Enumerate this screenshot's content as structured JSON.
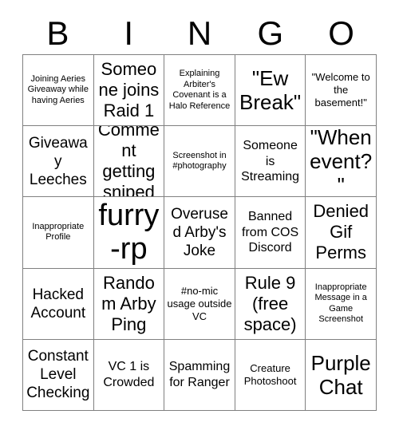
{
  "card": {
    "header_letters": [
      "B",
      "I",
      "N",
      "G",
      "O"
    ],
    "colors": {
      "background": "#ffffff",
      "text": "#000000",
      "grid_line": "#808080"
    },
    "cells": [
      {
        "text": "Joining Aeries Giveaway while having Aeries",
        "size": "fs-xs"
      },
      {
        "text": "Someone joins Raid 1",
        "size": "fs-xl"
      },
      {
        "text": "Explaining Arbiter's Covenant is a Halo Reference",
        "size": "fs-xs"
      },
      {
        "text": "\"Ew Break\"",
        "size": "fs-xxl"
      },
      {
        "text": "\"Welcome to the basement!\"",
        "size": "fs-sm"
      },
      {
        "text": "Giveaway Leeches",
        "size": "fs-lg"
      },
      {
        "text": "Comment getting sniped",
        "size": "fs-xl"
      },
      {
        "text": "Screenshot in #photography",
        "size": "fs-xs"
      },
      {
        "text": "Someone is Streaming",
        "size": "fs-md"
      },
      {
        "text": "\"When event?\"",
        "size": "fs-xxl"
      },
      {
        "text": "Inappropriate Profile",
        "size": "fs-xs"
      },
      {
        "text": "furry-rp",
        "size": "fs-huge"
      },
      {
        "text": "Overused Arby's Joke",
        "size": "fs-lg"
      },
      {
        "text": "Banned from COS Discord",
        "size": "fs-md"
      },
      {
        "text": "Denied Gif Perms",
        "size": "fs-xl"
      },
      {
        "text": "Hacked Account",
        "size": "fs-lg"
      },
      {
        "text": "Random Arby Ping",
        "size": "fs-xl"
      },
      {
        "text": "#no-mic usage outside VC",
        "size": "fs-sm"
      },
      {
        "text": "Rule 9 (free space)",
        "size": "fs-xl"
      },
      {
        "text": "Inappropriate Message in a Game Screenshot",
        "size": "fs-xs"
      },
      {
        "text": "Constant Level Checking",
        "size": "fs-lg"
      },
      {
        "text": "VC 1 is Crowded",
        "size": "fs-md"
      },
      {
        "text": "Spamming for Ranger",
        "size": "fs-md"
      },
      {
        "text": "Creature Photoshoot",
        "size": "fs-sm"
      },
      {
        "text": "Purple Chat",
        "size": "fs-xxl"
      }
    ]
  }
}
